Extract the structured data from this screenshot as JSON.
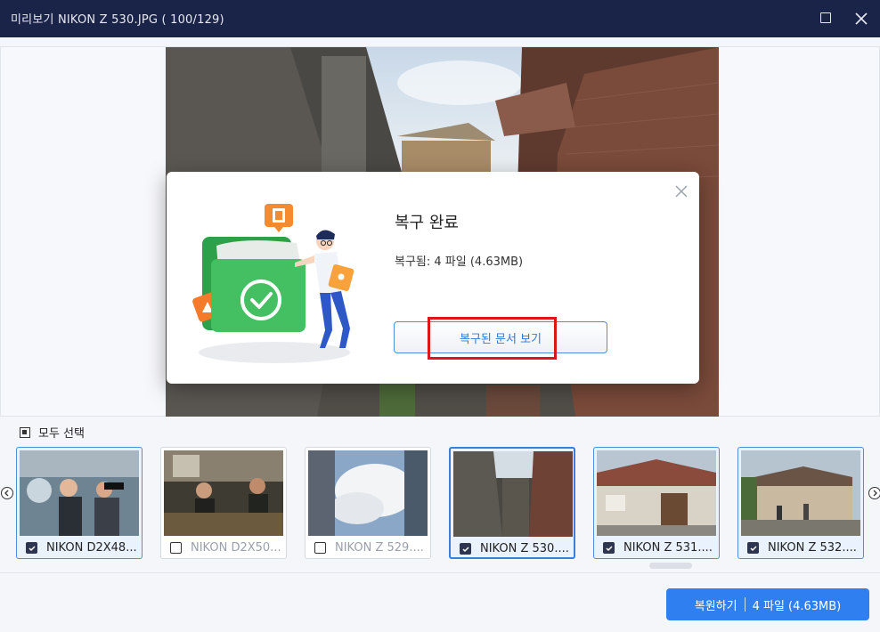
{
  "window": {
    "title": "미리보기 NIKON Z 530.JPG ( 100/129)"
  },
  "dialog": {
    "title": "복구 완료",
    "summary": "복구됨: 4 파일 (4.63MB)",
    "view_button": "복구된 문서 보기"
  },
  "selection": {
    "select_all_label": "모두 선택"
  },
  "thumbnails": [
    {
      "label": "NIKON D2X48...",
      "checked": true
    },
    {
      "label": "NIKON D2X50...",
      "checked": false
    },
    {
      "label": "NIKON Z 529....",
      "checked": false
    },
    {
      "label": "NIKON Z 530....",
      "checked": true
    },
    {
      "label": "NIKON Z 531....",
      "checked": true
    },
    {
      "label": "NIKON Z 532....",
      "checked": true
    }
  ],
  "footer": {
    "recover_label": "복원하기",
    "recover_count": "4 파일 (4.63MB)"
  },
  "colors": {
    "titlebar": "#1a2348",
    "accent": "#2f7ff0",
    "highlight_box": "#e0141c"
  },
  "icons": [
    "maximize-icon",
    "close-icon",
    "dialog-close-icon",
    "recovery-complete-illustration",
    "chevron-left-icon",
    "chevron-right-icon"
  ]
}
